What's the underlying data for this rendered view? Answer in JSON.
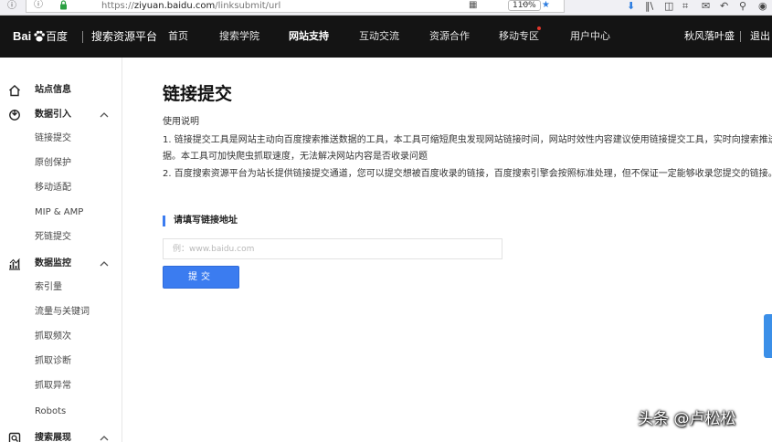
{
  "browser": {
    "url_prefix": "https://",
    "url_domain": "ziyuan.baidu.com",
    "url_path": "/linksubmit/url",
    "zoom": "110%"
  },
  "topnav": {
    "logo_text_bai": "Bai",
    "logo_text_du": "百度",
    "platform_name": "搜索资源平台",
    "items": [
      {
        "label": "首页"
      },
      {
        "label": "搜索学院"
      },
      {
        "label": "网站支持"
      },
      {
        "label": "互动交流"
      },
      {
        "label": "资源合作"
      },
      {
        "label": "移动专区"
      },
      {
        "label": "用户中心"
      }
    ],
    "user_name": "秋风落叶盛",
    "logout_label": "退出"
  },
  "sidebar": {
    "site_info": {
      "label": "站点信息",
      "icon": "home-icon"
    },
    "groups": [
      {
        "label": "数据引入",
        "icon": "data-import-icon",
        "items": [
          "链接提交",
          "原创保护",
          "移动适配",
          "MIP & AMP",
          "死链提交"
        ]
      },
      {
        "label": "数据监控",
        "icon": "chart-icon",
        "items": [
          "索引量",
          "流量与关键词",
          "抓取频次",
          "抓取诊断",
          "抓取异常",
          "Robots"
        ]
      },
      {
        "label": "搜索展现",
        "icon": "search-display-icon",
        "items": []
      }
    ]
  },
  "main": {
    "title": "链接提交",
    "usage_title": "使用说明",
    "usage_lines": [
      "1. 链接提交工具是网站主动向百度搜索推送数据的工具，本工具可缩短爬虫发现网站链接时间，网站时效性内容建议使用链接提交工具，实时向搜索推送数",
      "据。本工具可加快爬虫抓取速度，无法解决网站内容是否收录问题",
      "2. 百度搜索资源平台为站长提供链接提交通道，您可以提交想被百度收录的链接，百度搜索引擎会按照标准处理，但不保证一定能够收录您提交的链接。"
    ],
    "section_title": "请填写链接地址",
    "input_placeholder": "例：www.baidu.com",
    "input_value": "",
    "submit_label": "提交"
  },
  "watermark": "头条 @卢松松",
  "colors": {
    "accent": "#3b7cf0",
    "nav_bg": "#141414",
    "notify_dot": "#e0362b"
  }
}
